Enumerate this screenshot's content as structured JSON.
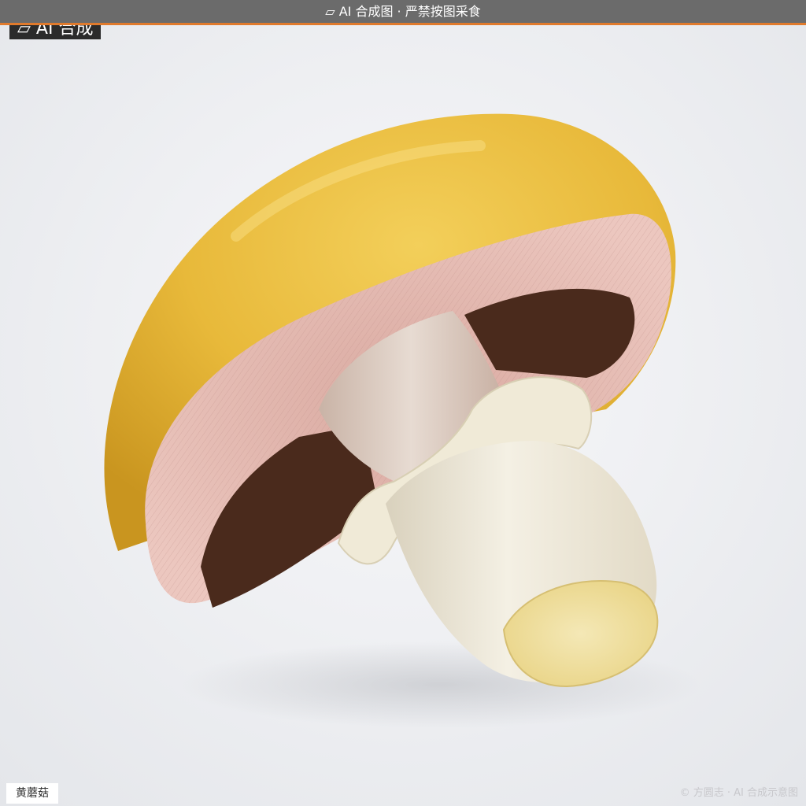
{
  "banner": {
    "icon": "sparkle-icon",
    "text": "AI 合成图 · 严禁按图采食"
  },
  "badge": {
    "icon": "sparkle-icon",
    "text": "AI 合成"
  },
  "photo": {
    "subject": "mushroom",
    "colors": {
      "cap": "#e8b93a",
      "gills": "#e6b9b0",
      "dark_gills": "#4a2a1c",
      "stem": "#efeadb",
      "background": "#eceef1"
    }
  },
  "caption": {
    "label": "黄蘑菇"
  },
  "credit": {
    "text": "© 方圆志 · AI 合成示意图"
  }
}
